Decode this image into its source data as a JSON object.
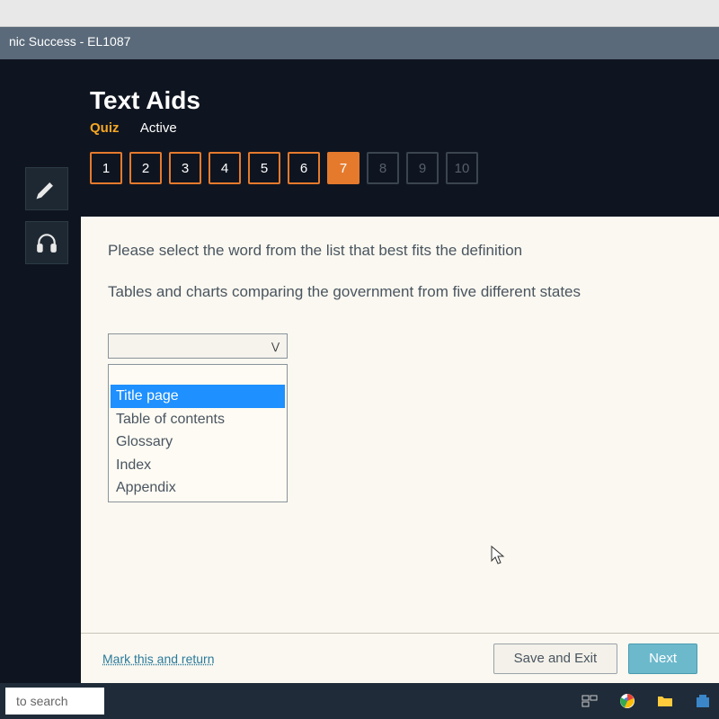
{
  "browser_tab_title": "nic Success - EL1087",
  "lesson_title": "Text Aids",
  "nav": {
    "quiz_label": "Quiz",
    "mode_label": "Active"
  },
  "questions": {
    "items": [
      {
        "n": "1",
        "state": "open"
      },
      {
        "n": "2",
        "state": "open"
      },
      {
        "n": "3",
        "state": "open"
      },
      {
        "n": "4",
        "state": "open"
      },
      {
        "n": "5",
        "state": "open"
      },
      {
        "n": "6",
        "state": "open"
      },
      {
        "n": "7",
        "state": "current"
      },
      {
        "n": "8",
        "state": "disabled"
      },
      {
        "n": "9",
        "state": "disabled"
      },
      {
        "n": "10",
        "state": "disabled"
      }
    ]
  },
  "prompt": {
    "instruction": "Please select the word from the list that best fits the definition",
    "definition": "Tables and charts comparing the government from five different states"
  },
  "dropdown": {
    "selected": "",
    "options": [
      {
        "label": "",
        "highlighted": false,
        "blank": true
      },
      {
        "label": "Title page",
        "highlighted": true
      },
      {
        "label": "Table of contents",
        "highlighted": false
      },
      {
        "label": "Glossary",
        "highlighted": false
      },
      {
        "label": "Index",
        "highlighted": false
      },
      {
        "label": "Appendix",
        "highlighted": false
      }
    ]
  },
  "footer": {
    "mark_return": "Mark this and return",
    "save_exit": "Save and Exit",
    "next": "Next"
  },
  "taskbar": {
    "search_placeholder": "to search"
  }
}
